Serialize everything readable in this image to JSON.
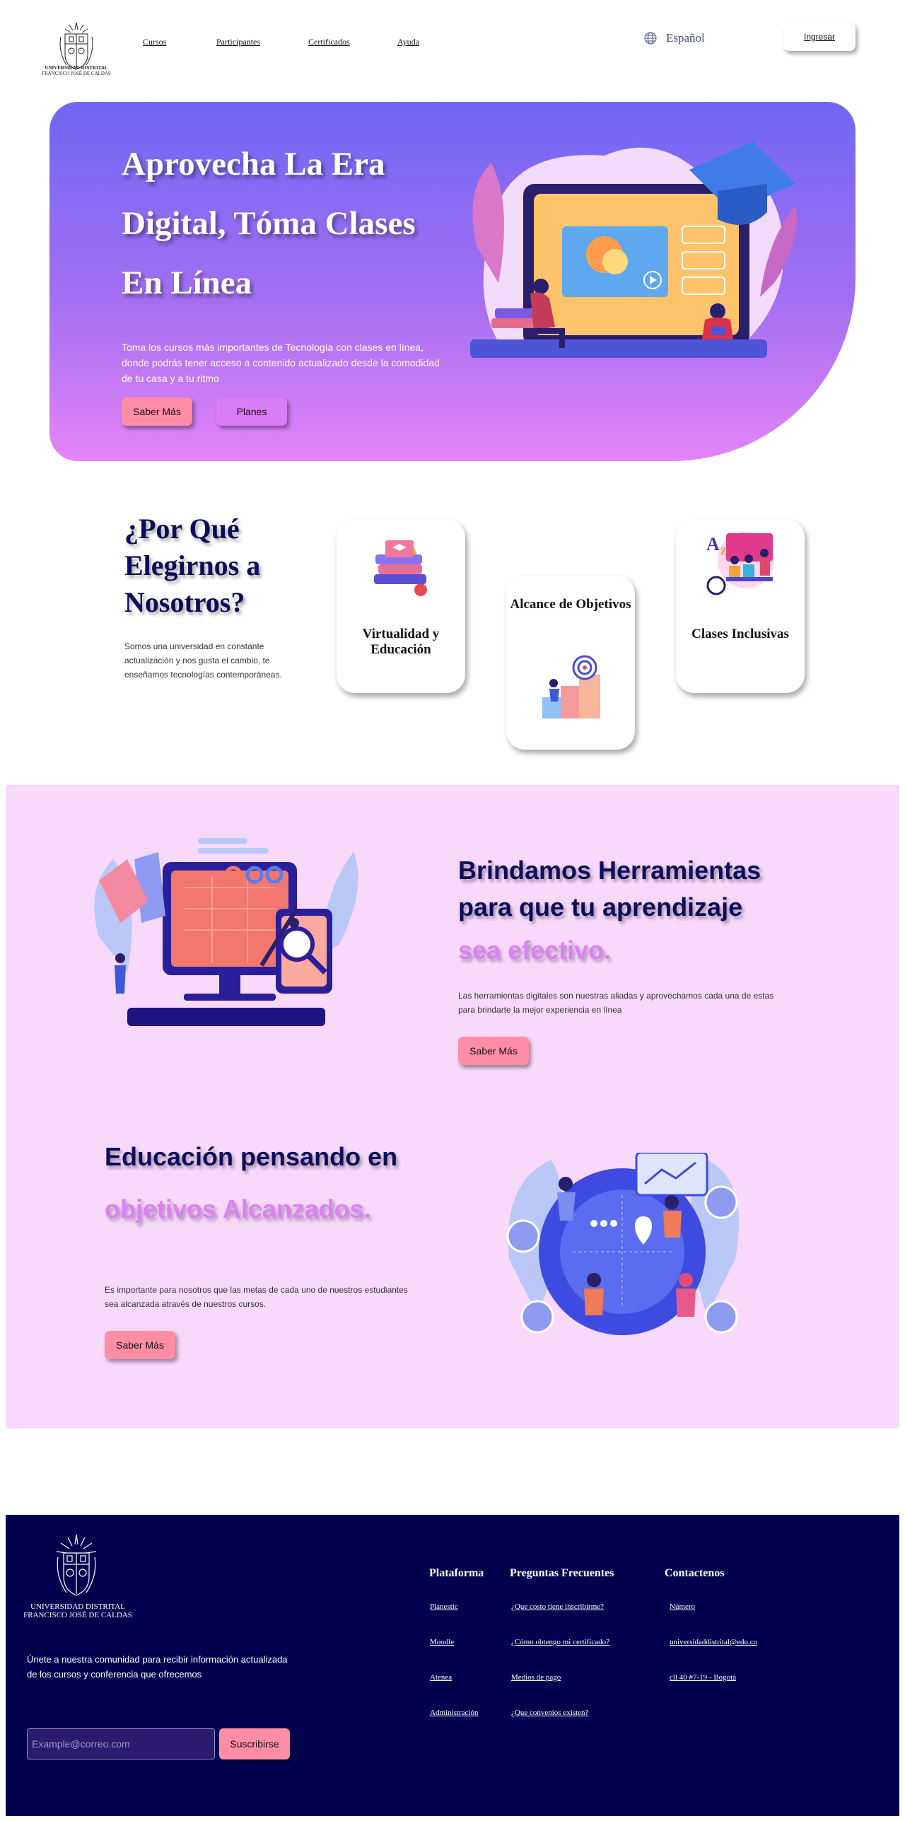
{
  "header": {
    "logo_caption": [
      "UNIVERSIDAD DISTRITAL",
      "FRANCISCO JOSÉ DE CALDAS"
    ],
    "nav": [
      "Cursos",
      "Participantes",
      "Certificados",
      "Ayuda"
    ],
    "language": "Español",
    "login": "Ingresar"
  },
  "hero": {
    "title": "Aprovecha La Era Digital, Tóma Clases En Línea",
    "text": "Toma los cursos más importantes de Tecnología con clases en línea, donde podrás tener acceso a contenido actualizado desde la comodidad de tu casa y a tu ritmo",
    "primary_button": "Saber Más",
    "secondary_button": "Planes"
  },
  "why": {
    "title": "¿Por Qué Elegirnos a Nosotros?",
    "text": "Somos una universidad en constante actualización y nos gusta el cambio, te enseñamos tecnologías contemporáneas.",
    "cards": [
      "Virtualidad y Educación",
      "Alcance de Objetivos",
      "Clases Inclusivas"
    ]
  },
  "tools": {
    "title": "Brindamos Herramientas para que tu aprendizaje",
    "accent": "sea efectivo.",
    "text": "Las herramientas digitales son nuestras aliadas y aprovechamos cada una de estas para brindarte la mejor experiencia en línea",
    "button": "Saber Más"
  },
  "goals": {
    "title": "Educación pensando en",
    "accent": "objetivos Alcanzados.",
    "text": "Es importante para nosotros que las metas de cada uno de nuestros estudiantes sea alcanzada através de nuestros cursos.",
    "button": "Saber Más"
  },
  "footer": {
    "logo_caption": [
      "UNIVERSIDAD DISTRITAL",
      "FRANCISCO JOSÉ DE CALDAS"
    ],
    "join_text": "Únete a nuestra comunidad para recibir información actualizada de los cursos y conferencia que ofrecemos",
    "email_placeholder": "Example@correo.com",
    "subscribe": "Suscribirse",
    "columns": [
      {
        "title": "Plataforma",
        "links": [
          "Planestic",
          "Moodle",
          "Atenea",
          "Administración"
        ]
      },
      {
        "title": "Preguntas Frecuentes",
        "links": [
          "¿Que costo tiene inscribirme?",
          "¿Cómo obtengo mi certificado?",
          "Medios de pago",
          "¿Que convenios existen?"
        ]
      },
      {
        "title": "Contactenos",
        "links": [
          "Número",
          "universidaddistrital@edu.co",
          "cll 40 #7-19 - Bogotá"
        ]
      }
    ]
  },
  "colors": {
    "navy": "#0d0c5a",
    "footer_bg": "#03024f",
    "pink_button": "#ff8ea4",
    "violet_button": "#d97cf5",
    "accent_text": "#dc80f4",
    "section_bg": "#f8d9fc"
  }
}
